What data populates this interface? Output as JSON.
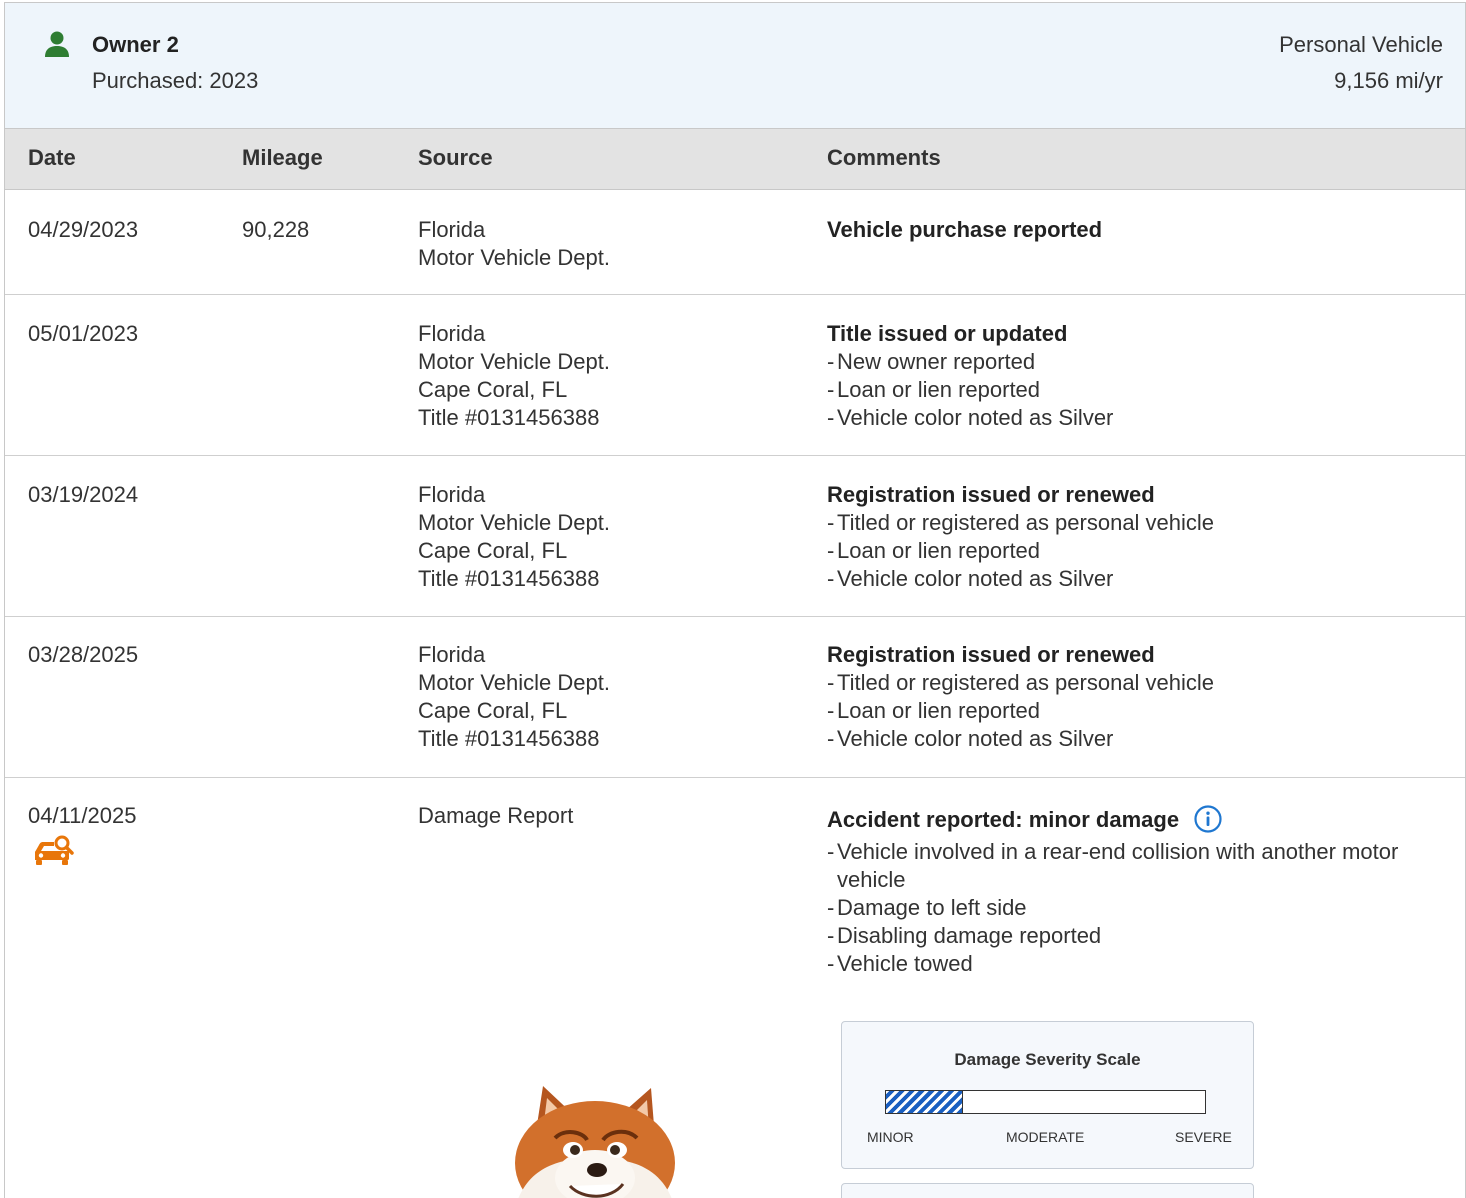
{
  "owner": {
    "title": "Owner 2",
    "purchased": "Purchased: 2023",
    "vehicle_type": "Personal Vehicle",
    "mileage_per_year": "9,156 mi/yr"
  },
  "columns": {
    "date": "Date",
    "mileage": "Mileage",
    "source": "Source",
    "comments": "Comments"
  },
  "rows": [
    {
      "date": "04/29/2023",
      "mileage": "90,228",
      "source": [
        "Florida",
        "Motor Vehicle Dept."
      ],
      "comment_title": "Vehicle purchase reported",
      "comment_lines": []
    },
    {
      "date": "05/01/2023",
      "mileage": "",
      "source": [
        "Florida",
        "Motor Vehicle Dept.",
        "Cape Coral, FL",
        "Title #0131456388"
      ],
      "comment_title": "Title issued or updated",
      "comment_lines": [
        "New owner reported",
        "Loan or lien reported",
        "Vehicle color noted as Silver"
      ]
    },
    {
      "date": "03/19/2024",
      "mileage": "",
      "source": [
        "Florida",
        "Motor Vehicle Dept.",
        "Cape Coral, FL",
        "Title #0131456388"
      ],
      "comment_title": "Registration issued or renewed",
      "comment_lines": [
        "Titled or registered as personal vehicle",
        "Loan or lien reported",
        "Vehicle color noted as Silver"
      ]
    },
    {
      "date": "03/28/2025",
      "mileage": "",
      "source": [
        "Florida",
        "Motor Vehicle Dept.",
        "Cape Coral, FL",
        "Title #0131456388"
      ],
      "comment_title": "Registration issued or renewed",
      "comment_lines": [
        "Titled or registered as personal vehicle",
        "Loan or lien reported",
        "Vehicle color noted as Silver"
      ]
    },
    {
      "date": "04/11/2025",
      "mileage": "",
      "source": [
        "Damage Report"
      ],
      "comment_title": "Accident reported: minor damage",
      "comment_lines": [
        "Vehicle involved in a rear-end collision with another motor vehicle",
        "Damage to left side",
        "Disabling damage reported",
        "Vehicle towed"
      ]
    }
  ],
  "damage_scale": {
    "title": "Damage Severity Scale",
    "level_fraction": 0.24,
    "labels": {
      "minor": "MINOR",
      "moderate": "MODERATE",
      "severe": "SEVERE"
    }
  },
  "icons": {
    "owner": "person-icon",
    "damage": "car-damage-search-icon",
    "info": "info-icon"
  },
  "colors": {
    "owner_icon": "#2e7d32",
    "damage_icon": "#e8760a",
    "info_icon": "#1f77d0",
    "severity_fill": "#1a5fc0"
  }
}
